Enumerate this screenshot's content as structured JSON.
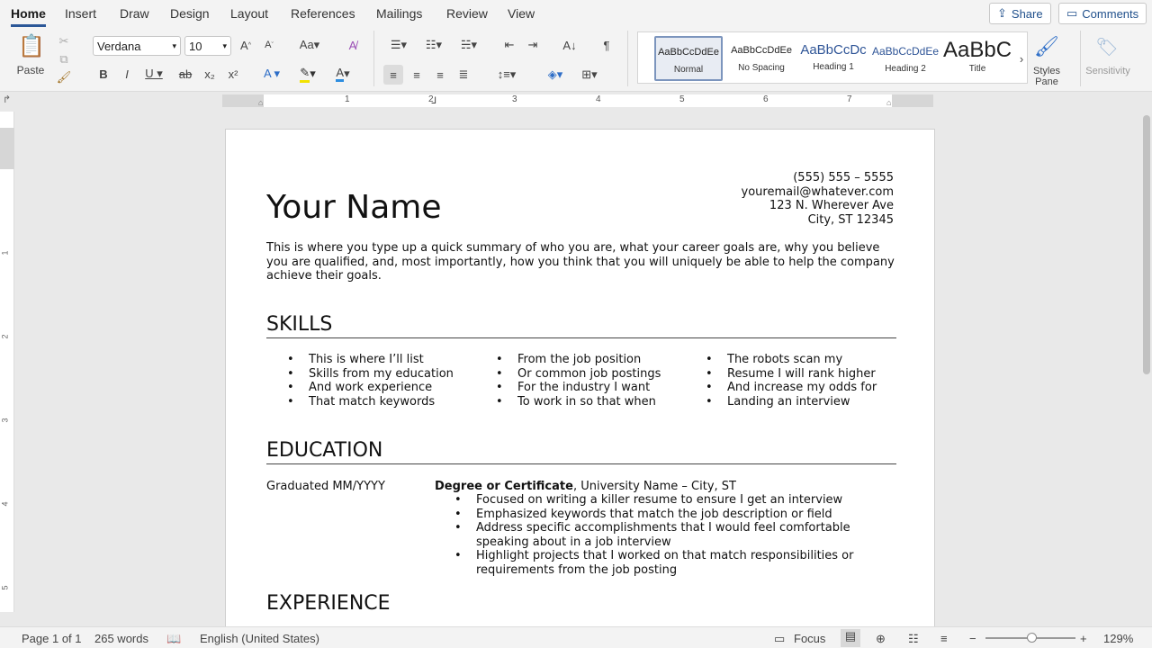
{
  "tabs": [
    "Home",
    "Insert",
    "Draw",
    "Design",
    "Layout",
    "References",
    "Mailings",
    "Review",
    "View"
  ],
  "active_tab": "Home",
  "header": {
    "share": "Share",
    "comments": "Comments"
  },
  "ribbon": {
    "paste": "Paste",
    "font_name": "Verdana",
    "font_size": "10",
    "styles": [
      {
        "preview": "AaBbCcDdEe",
        "label": "Normal"
      },
      {
        "preview": "AaBbCcDdEe",
        "label": "No Spacing"
      },
      {
        "preview": "AaBbCcDc",
        "label": "Heading 1"
      },
      {
        "preview": "AaBbCcDdEe",
        "label": "Heading 2"
      },
      {
        "preview": "AaBbC",
        "label": "Title"
      }
    ],
    "styles_pane": "Styles Pane",
    "sensitivity": "Sensitivity"
  },
  "ruler": {
    "numbers": [
      "1",
      "2",
      "3",
      "4",
      "5",
      "6",
      "7"
    ]
  },
  "vruler": {
    "numbers": [
      "1",
      "2",
      "3",
      "4",
      "5"
    ]
  },
  "document": {
    "contact": [
      "(555) 555 – 5555",
      "youremail@whatever.com",
      "123 N. Wherever Ave",
      "City, ST 12345"
    ],
    "name": "Your Name",
    "summary": "This is where you type up a quick summary of who you are, what your career goals are, why you believe you are qualified, and, most importantly, how you think that you will uniquely be able to help the company achieve their goals.",
    "skills_heading": "SKILLS",
    "skills": [
      [
        "This is where I’ll list",
        "Skills from my education",
        "And work experience",
        "That match keywords"
      ],
      [
        "From the job position",
        "Or common job postings",
        "For the industry I want",
        "To work in so that when"
      ],
      [
        "The robots scan my",
        "Resume I will rank higher",
        "And increase my odds for",
        "Landing an interview"
      ]
    ],
    "education_heading": "EDUCATION",
    "graduated": "Graduated MM/YYYY",
    "degree_bold": "Degree or Certificate",
    "degree_rest": ", University Name – City, ST",
    "education_bullets": [
      "Focused on writing a killer resume to ensure I get an interview",
      "Emphasized keywords that match the job description or field",
      "Address specific accomplishments that I would feel comfortable speaking about in a job interview",
      "Highlight projects that I worked on that match responsibilities or requirements from the job posting"
    ],
    "experience_heading": "EXPERIENCE"
  },
  "status": {
    "page": "Page 1 of 1",
    "words": "265 words",
    "language": "English (United States)",
    "focus": "Focus",
    "zoom": "129%"
  }
}
